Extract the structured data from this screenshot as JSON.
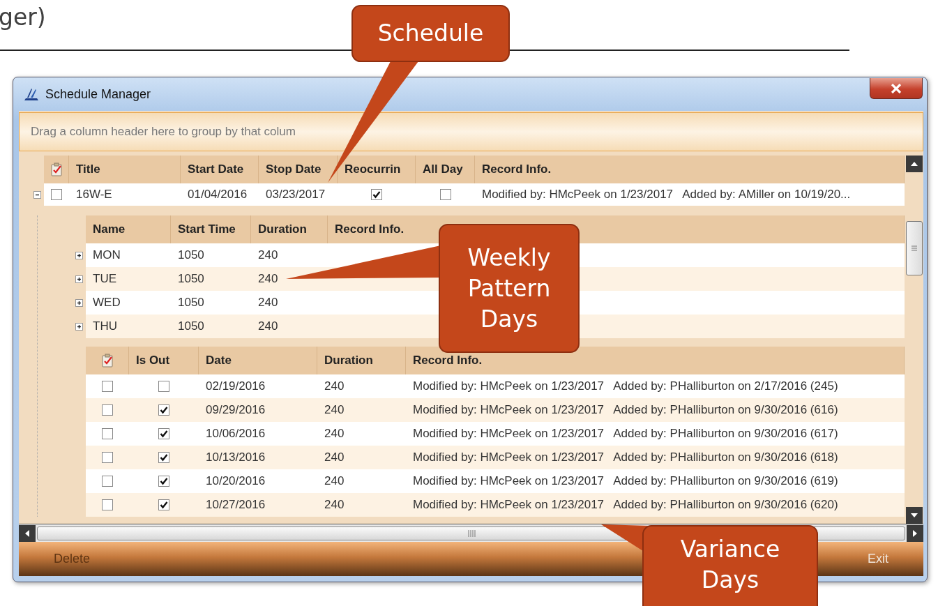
{
  "slide": {
    "title_fragment": "ger)"
  },
  "window": {
    "title": "Schedule Manager"
  },
  "group_panel": {
    "hint": "Drag a column header here to group by that colum"
  },
  "schedule_table": {
    "columns": [
      "Title",
      "Start Date",
      "Stop Date",
      "Reocurrin",
      "All Day",
      "Record Info."
    ],
    "rows": [
      {
        "expanded": true,
        "checked": false,
        "title": "16W-E",
        "start_date": "01/04/2016",
        "stop_date": "03/23/2017",
        "reoccurring": true,
        "all_day": false,
        "record_info": "Modified by: HMcPeek on 1/23/2017   Added by: AMiller on 10/19/20..."
      }
    ]
  },
  "pattern_table": {
    "columns": [
      "Name",
      "Start Time",
      "Duration",
      "Record Info."
    ],
    "rows": [
      {
        "expanded": false,
        "name": "MON",
        "start_time": "1050",
        "duration": "240"
      },
      {
        "expanded": false,
        "name": "TUE",
        "start_time": "1050",
        "duration": "240"
      },
      {
        "expanded": false,
        "name": "WED",
        "start_time": "1050",
        "duration": "240"
      },
      {
        "expanded": false,
        "name": "THU",
        "start_time": "1050",
        "duration": "240"
      }
    ]
  },
  "variance_table": {
    "columns": [
      "Is Out",
      "Date",
      "Duration",
      "Record Info."
    ],
    "rows": [
      {
        "checked": false,
        "is_out": false,
        "date": "02/19/2016",
        "duration": "240",
        "record_info": "Modified by: HMcPeek on 1/23/2017   Added by: PHalliburton on 2/17/2016 (245)"
      },
      {
        "checked": false,
        "is_out": true,
        "date": "09/29/2016",
        "duration": "240",
        "record_info": "Modified by: HMcPeek on 1/23/2017   Added by: PHalliburton on 9/30/2016 (616)"
      },
      {
        "checked": false,
        "is_out": true,
        "date": "10/06/2016",
        "duration": "240",
        "record_info": "Modified by: HMcPeek on 1/23/2017   Added by: PHalliburton on 9/30/2016 (617)"
      },
      {
        "checked": false,
        "is_out": true,
        "date": "10/13/2016",
        "duration": "240",
        "record_info": "Modified by: HMcPeek on 1/23/2017   Added by: PHalliburton on 9/30/2016 (618)"
      },
      {
        "checked": false,
        "is_out": true,
        "date": "10/20/2016",
        "duration": "240",
        "record_info": "Modified by: HMcPeek on 1/23/2017   Added by: PHalliburton on 9/30/2016 (619)"
      },
      {
        "checked": false,
        "is_out": true,
        "date": "10/27/2016",
        "duration": "240",
        "record_info": "Modified by: HMcPeek on 1/23/2017   Added by: PHalliburton on 9/30/2016 (620)"
      }
    ]
  },
  "buttons": [
    {
      "label": "Delete",
      "disabled": true
    },
    {
      "label": "Exit",
      "disabled": false
    }
  ],
  "callouts": [
    {
      "text": "Schedule"
    },
    {
      "text": "Weekly Pattern Days"
    },
    {
      "text": "Variance Days"
    }
  ]
}
